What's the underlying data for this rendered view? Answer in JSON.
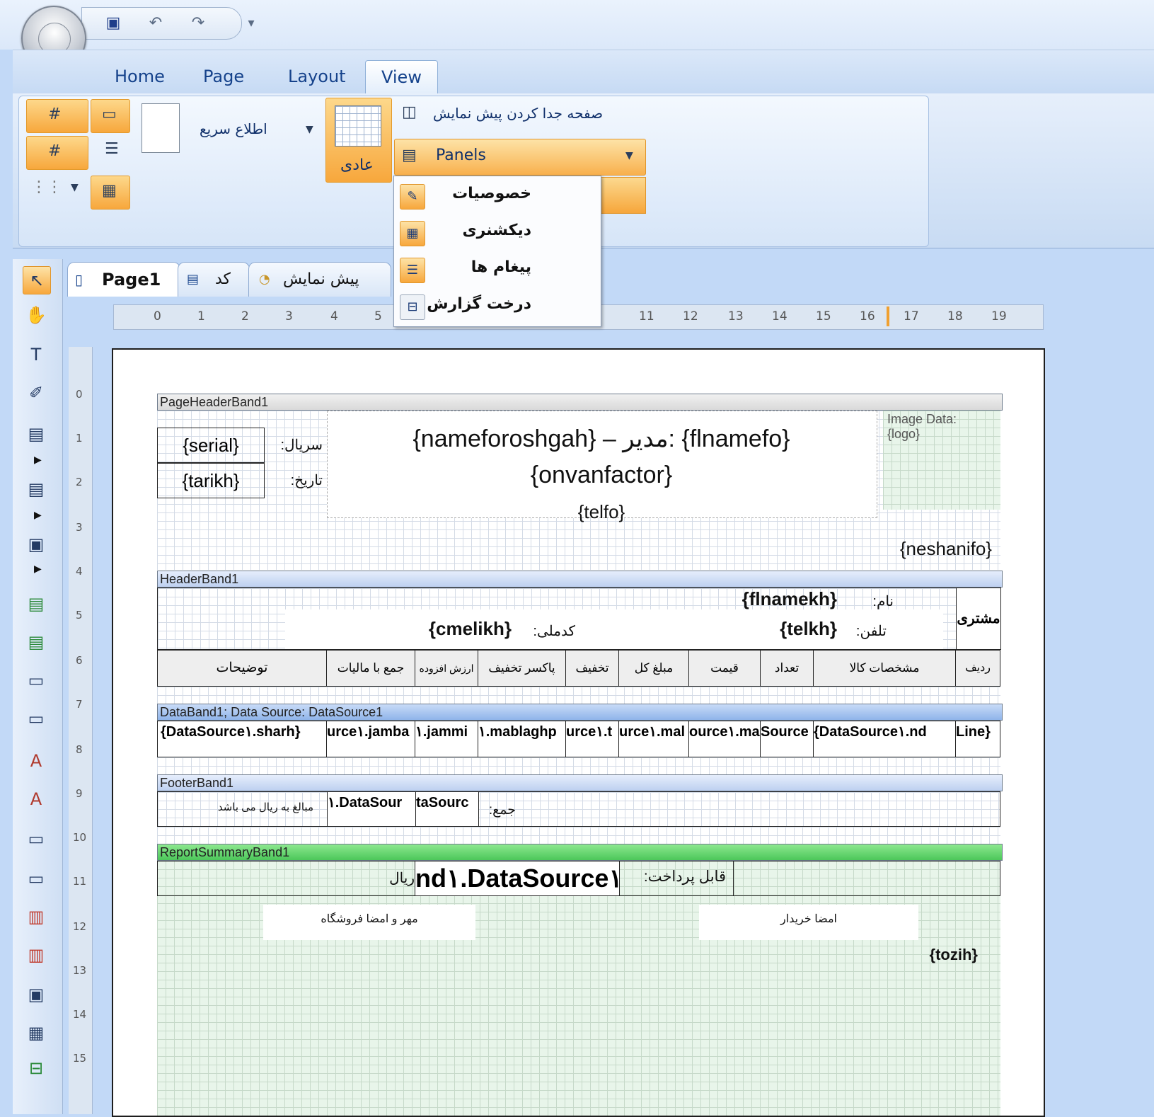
{
  "ribbon_tabs": [
    "Home",
    "Page",
    "Layout",
    "View"
  ],
  "ribbon": {
    "quick_info": "اطلاع سریع",
    "normal_view": "عادی",
    "preview_separate": "صفحه جدا کردن پیش نمایش",
    "panels_label": "Panels"
  },
  "panels_menu": [
    "خصوصیات",
    "دیکشنری",
    "پیغام ها",
    "درخت گزارش"
  ],
  "doc_tabs": {
    "page": "Page1",
    "code": "کد",
    "preview": "پیش نمایش"
  },
  "ruler_h": [
    "0",
    "1",
    "2",
    "3",
    "4",
    "5",
    "11",
    "12",
    "13",
    "14",
    "15",
    "16",
    "17",
    "18",
    "19"
  ],
  "ruler_v": [
    "0",
    "1",
    "2",
    "3",
    "4",
    "5",
    "6",
    "7",
    "8",
    "9",
    "10",
    "11",
    "12",
    "13",
    "14",
    "15"
  ],
  "report": {
    "bands": {
      "page_header": "PageHeaderBand1",
      "header": "HeaderBand1",
      "data": "DataBand1; Data Source: DataSource1",
      "footer": "FooterBand1",
      "summary": "ReportSummaryBand1"
    },
    "page_header": {
      "serial_value": "{serial}",
      "serial_label": "سریال:",
      "date_value": "{tarikh}",
      "date_label": "تاریخ:",
      "title_line": "{nameforoshgah} – مدیر: {flnamefo}",
      "invoice_title": "{onvanfactor}",
      "phone": "{telfo}",
      "image_data": "Image Data:\n{logo}",
      "address": "{neshanifo}"
    },
    "header": {
      "name_value": "{flnamekh}",
      "name_label": "نام:",
      "national_value": "{cmelikh}",
      "national_label": "کدملی:",
      "tel_value": "{telkh}",
      "tel_label": "تلفن:",
      "customer_label": "مشتری",
      "columns": [
        "توضیحات",
        "جمع با مالیات",
        "ارزش افزوده",
        "پاکسر تخفیف",
        "تخفیف",
        "مبلغ کل",
        "قیمت",
        "تعداد",
        "مشخصات کالا",
        "ردیف"
      ]
    },
    "data_row": [
      "{DataSource١.sharh}",
      "urce١.jamba",
      "١.jammi",
      "١.mablaghp",
      "urce١.t",
      "urce١.mal",
      "ource١.ma",
      "Source",
      "{DataSource١.nd",
      "Line}"
    ],
    "footer": {
      "note": "مبالغ به ریال می باشد",
      "sum1": "١.DataSour",
      "sum2": "taSourc",
      "sum_label": "جمع:"
    },
    "summary": {
      "currency": "ریال",
      "payable_value": "nd١.DataSource١",
      "payable_label": "قابل پرداخت:",
      "shop_sign": "مهر و امضا فروشگاه",
      "buyer_sign": "امضا خریدار",
      "description": "{tozih}"
    }
  }
}
